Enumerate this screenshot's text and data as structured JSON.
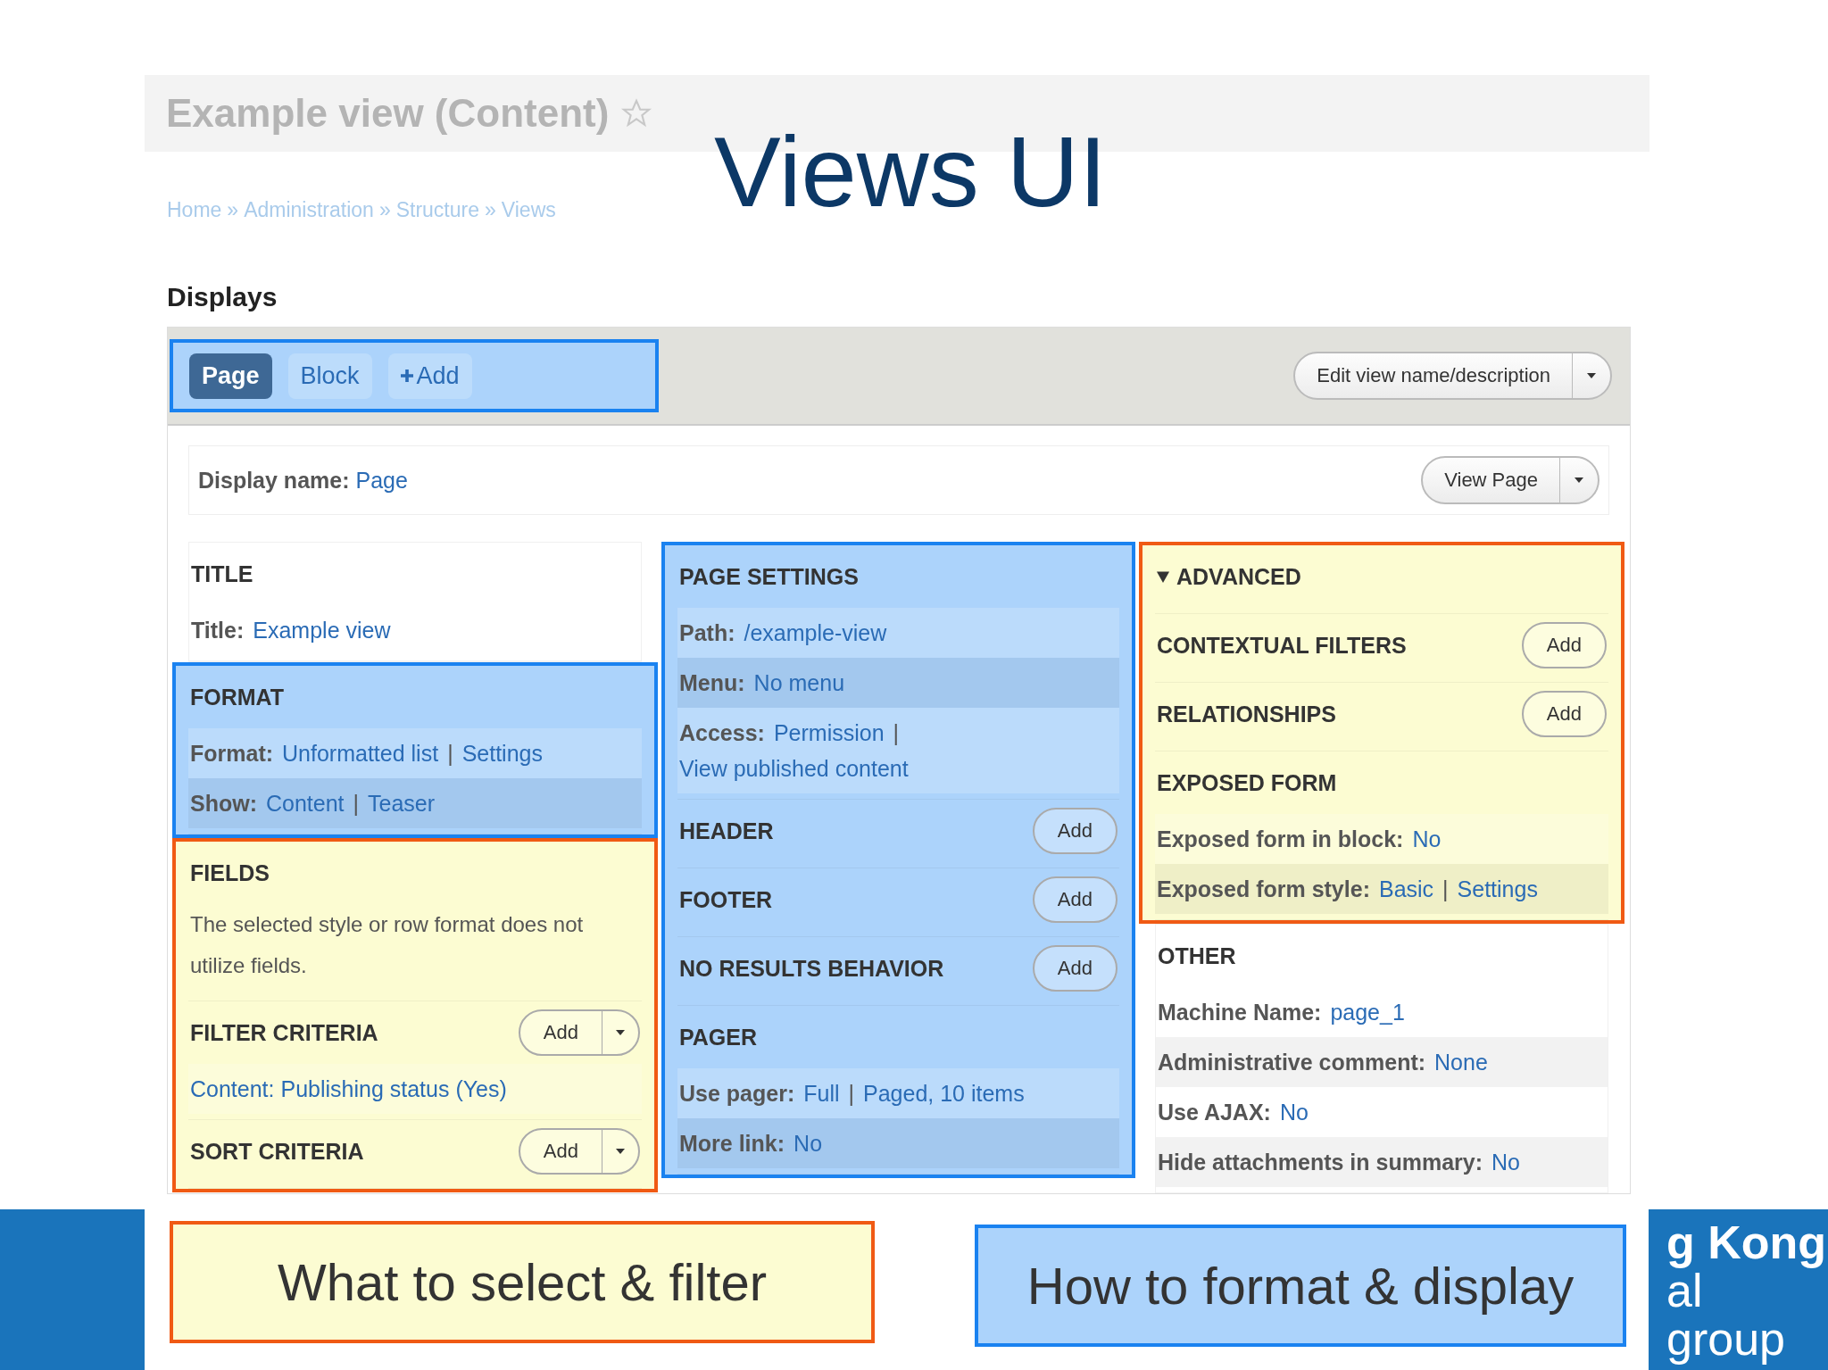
{
  "slide_title": "Views UI",
  "page": {
    "title": "Example view (Content)",
    "breadcrumb": [
      "Home",
      "»",
      "Administration",
      "»",
      "Structure",
      "»",
      "Views"
    ],
    "section_heading": "Displays"
  },
  "display_tabs": [
    {
      "label": "Page",
      "selected": true,
      "icon": false
    },
    {
      "label": "Block",
      "selected": false,
      "icon": false
    },
    {
      "label": "Add",
      "selected": false,
      "icon": true
    }
  ],
  "edit_button": "Edit view name/description",
  "display_name": {
    "label": "Display name:",
    "value": "Page",
    "button": "View Page"
  },
  "columns": [
    [
      {
        "sections": [
          {
            "heading": "TITLE",
            "rows": [
              {
                "label": "Title:",
                "shaded": false,
                "items": [
                  {
                    "kind": "link",
                    "text": "Example view"
                  }
                ]
              }
            ]
          }
        ]
      },
      {
        "color": "#1a82f0",
        "sections": [
          {
            "heading": "FORMAT",
            "rows": [
              {
                "label": "Format:",
                "shaded": false,
                "items": [
                  {
                    "kind": "link",
                    "text": "Unformatted list"
                  },
                  {
                    "kind": "sep",
                    "text": "|"
                  },
                  {
                    "kind": "link",
                    "text": "Settings"
                  }
                ]
              },
              {
                "label": "Show:",
                "shaded": true,
                "items": [
                  {
                    "kind": "link",
                    "text": "Content"
                  },
                  {
                    "kind": "sep",
                    "text": "|"
                  },
                  {
                    "kind": "link",
                    "text": "Teaser"
                  }
                ]
              }
            ]
          }
        ]
      },
      {
        "color": "#f05a14",
        "sections": [
          {
            "heading": "FIELDS",
            "note": "The selected style or row format does not utilize fields."
          },
          {
            "heading": "FILTER CRITERIA",
            "add": "Add",
            "dropdown": true,
            "rows": [
              {
                "shaded": false,
                "items": [
                  {
                    "kind": "link",
                    "text": "Content: Publishing status (Yes)"
                  }
                ]
              }
            ]
          },
          {
            "heading": "SORT CRITERIA",
            "add": "Add",
            "dropdown": true
          }
        ]
      }
    ],
    [
      {
        "color": "#1a82f0",
        "sections": [
          {
            "heading": "PAGE SETTINGS",
            "rows": [
              {
                "label": "Path:",
                "shaded": false,
                "items": [
                  {
                    "kind": "link",
                    "text": "/example-view"
                  }
                ]
              },
              {
                "label": "Menu:",
                "shaded": true,
                "items": [
                  {
                    "kind": "link",
                    "text": "No menu"
                  }
                ]
              },
              {
                "label": "Access:",
                "shaded": false,
                "items": [
                  {
                    "kind": "link",
                    "text": "Permission"
                  },
                  {
                    "kind": "sep",
                    "text": "|"
                  },
                  {
                    "kind": "link",
                    "text": "View published content"
                  }
                ]
              }
            ]
          },
          {
            "heading": "HEADER",
            "add": "Add",
            "dropdown": false
          },
          {
            "heading": "FOOTER",
            "add": "Add",
            "dropdown": false
          },
          {
            "heading": "NO RESULTS BEHAVIOR",
            "add": "Add",
            "dropdown": false
          },
          {
            "heading": "PAGER",
            "rows": [
              {
                "label": "Use pager:",
                "shaded": false,
                "items": [
                  {
                    "kind": "link",
                    "text": "Full"
                  },
                  {
                    "kind": "sep",
                    "text": "|"
                  },
                  {
                    "kind": "link",
                    "text": "Paged, 10 items"
                  }
                ]
              },
              {
                "label": "More link:",
                "shaded": true,
                "items": [
                  {
                    "kind": "link",
                    "text": "No"
                  }
                ]
              }
            ]
          }
        ]
      }
    ],
    [
      {
        "color": "#f05a14",
        "sections": [
          {
            "heading": "ADVANCED",
            "expanded": true
          },
          {
            "heading": "CONTEXTUAL FILTERS",
            "add": "Add",
            "dropdown": false
          },
          {
            "heading": "RELATIONSHIPS",
            "add": "Add",
            "dropdown": false
          },
          {
            "heading": "EXPOSED FORM",
            "rows": [
              {
                "label": "Exposed form in block:",
                "shaded": false,
                "items": [
                  {
                    "kind": "link",
                    "text": "No"
                  }
                ]
              },
              {
                "label": "Exposed form style:",
                "shaded": true,
                "items": [
                  {
                    "kind": "link",
                    "text": "Basic"
                  },
                  {
                    "kind": "sep",
                    "text": "|"
                  },
                  {
                    "kind": "link",
                    "text": "Settings"
                  }
                ]
              }
            ]
          }
        ]
      },
      {
        "sections": [
          {
            "heading": "OTHER",
            "rows": [
              {
                "label": "Machine Name:",
                "shaded": false,
                "items": [
                  {
                    "kind": "link",
                    "text": "page_1"
                  }
                ]
              },
              {
                "label": "Administrative comment:",
                "shaded": true,
                "items": [
                  {
                    "kind": "link",
                    "text": "None"
                  }
                ]
              },
              {
                "label": "Use AJAX:",
                "shaded": false,
                "items": [
                  {
                    "kind": "link",
                    "text": "No"
                  }
                ]
              },
              {
                "label": "Hide attachments in summary:",
                "shaded": true,
                "items": [
                  {
                    "kind": "link",
                    "text": "No"
                  }
                ]
              }
            ]
          }
        ]
      }
    ]
  ],
  "callouts": [
    {
      "text": "What to select & filter",
      "color": "#f05a14"
    },
    {
      "text": "How to format & display",
      "color": "#1a82f0"
    }
  ],
  "logo_lines": [
    "g Kong",
    "al",
    "group"
  ]
}
